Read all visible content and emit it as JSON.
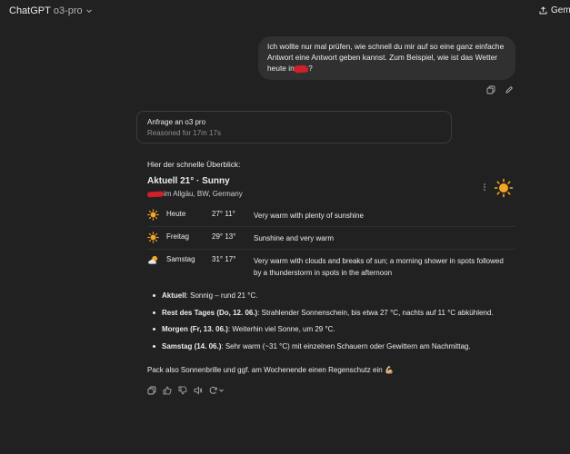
{
  "header": {
    "app_name": "ChatGPT",
    "model": "o3-pro",
    "share_label": "Geme"
  },
  "user_message": {
    "text_before": "Ich wollte nur mal prüfen, wie schnell du mir auf so eine ganz einfache Antwort eine Antwort geben kannst. Zum Beispiel, wie ist das Wetter heute in ",
    "text_after": "?"
  },
  "reasoning": {
    "title": "Anfrage an o3 pro",
    "subtitle": "Reasoned for 17m 17s"
  },
  "answer": {
    "intro": "Hier der schnelle Überblick:",
    "current_heading": "Aktuell 21° · Sunny",
    "location": "im Allgäu, BW, Germany",
    "forecast": [
      {
        "icon": "sun-icon",
        "day": "Heute",
        "temps": "27° 11°",
        "desc": "Very warm with plenty of sunshine"
      },
      {
        "icon": "sun-icon",
        "day": "Freitag",
        "temps": "29° 13°",
        "desc": "Sunshine and very warm"
      },
      {
        "icon": "partly-cloudy-icon",
        "day": "Samstag",
        "temps": "31° 17°",
        "desc": "Very warm with clouds and breaks of sun; a morning shower in spots followed by a thunderstorm in spots in the afternoon"
      }
    ],
    "bullets": [
      {
        "label": "Aktuell",
        "text": ": Sonnig – rund 21 °C."
      },
      {
        "label": "Rest des Tages (Do, 12. 06.)",
        "text": ": Strahlender Sonnenschein, bis etwa 27 °C, nachts auf 11 °C abkühlend."
      },
      {
        "label": "Morgen (Fr, 13. 06.)",
        "text": ": Weiterhin viel Sonne, um 29 °C."
      },
      {
        "label": "Samstag (14. 06.)",
        "text": ": Sehr warm (~31 °C) mit einzelnen Schauern oder Gewittern am Nachmittag."
      }
    ],
    "closing": "Pack also Sonnenbrille und ggf. am Wochenende einen Regenschutz ein",
    "closing_emoji": "💪🏼"
  },
  "colors": {
    "background": "#212121",
    "bubble": "#303030",
    "sun": "#f5a623",
    "redaction": "#d1202a"
  }
}
